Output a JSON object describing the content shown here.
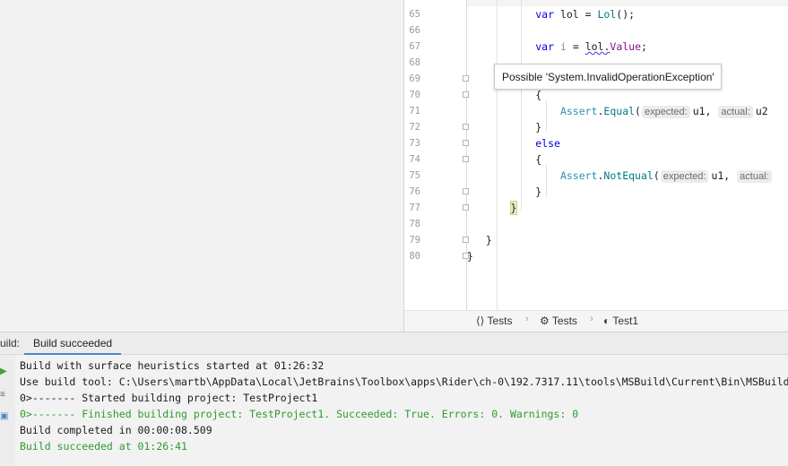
{
  "editor": {
    "lines": [
      {
        "num": "65",
        "code": [
          {
            "t": "var",
            "c": "kw"
          },
          {
            "t": " lol = ",
            "c": ""
          },
          {
            "t": "Lol",
            "c": "mc"
          },
          {
            "t": "();",
            "c": ""
          }
        ]
      },
      {
        "num": "66",
        "code": []
      },
      {
        "num": "67",
        "code": [
          {
            "t": "var",
            "c": "kw"
          },
          {
            "t": " ",
            "c": ""
          },
          {
            "t": "i",
            "c": "unused"
          },
          {
            "t": " = ",
            "c": ""
          },
          {
            "t": "lol",
            "c": "squiggle"
          },
          {
            "t": ".",
            "c": "squiggle"
          },
          {
            "t": "Value",
            "c": "prop"
          },
          {
            "t": ";",
            "c": ""
          }
        ]
      },
      {
        "num": "68",
        "code": []
      },
      {
        "num": "69",
        "code": []
      },
      {
        "num": "70",
        "code": [
          {
            "t": "{",
            "c": ""
          }
        ]
      },
      {
        "num": "71",
        "code": [
          {
            "t": "Assert",
            "c": "ty"
          },
          {
            "t": ".",
            "c": ""
          },
          {
            "t": "Equal",
            "c": "mc"
          },
          {
            "t": "(",
            "c": ""
          },
          {
            "hint": "expected:"
          },
          {
            "t": "u1, ",
            "c": ""
          },
          {
            "hint": "actual:"
          },
          {
            "t": "u2",
            "c": ""
          }
        ]
      },
      {
        "num": "72",
        "code": [
          {
            "t": "}",
            "c": ""
          }
        ]
      },
      {
        "num": "73",
        "code": [
          {
            "t": "else",
            "c": "kw"
          }
        ]
      },
      {
        "num": "74",
        "code": [
          {
            "t": "{",
            "c": ""
          }
        ]
      },
      {
        "num": "75",
        "code": [
          {
            "t": "Assert",
            "c": "ty"
          },
          {
            "t": ".",
            "c": ""
          },
          {
            "t": "NotEqual",
            "c": "mc"
          },
          {
            "t": "(",
            "c": ""
          },
          {
            "hint": "expected:"
          },
          {
            "t": "u1, ",
            "c": ""
          },
          {
            "hint": "actual:"
          }
        ]
      },
      {
        "num": "76",
        "code": [
          {
            "t": "}",
            "c": ""
          }
        ]
      },
      {
        "num": "77",
        "code": [
          {
            "t": "}",
            "c": "brace-hl"
          }
        ]
      },
      {
        "num": "78",
        "code": []
      },
      {
        "num": "79",
        "code": [
          {
            "t": "}",
            "c": ""
          }
        ]
      },
      {
        "num": "80",
        "code": [
          {
            "t": "}",
            "c": ""
          }
        ]
      }
    ],
    "tooltip": "Possible 'System.InvalidOperationException'"
  },
  "breadcrumb": [
    {
      "icon": "⟨⟩",
      "label": "Tests"
    },
    {
      "icon": "⚙",
      "label": "Tests"
    },
    {
      "icon": "◐",
      "label": "Test1"
    }
  ],
  "build": {
    "header_label": "uild:",
    "tab_label": "Build succeeded",
    "output": [
      {
        "text": "Build with surface heuristics started at 01:26:32",
        "green": false
      },
      {
        "text": "Use build tool: C:\\Users\\martb\\AppData\\Local\\JetBrains\\Toolbox\\apps\\Rider\\ch-0\\192.7317.11\\tools\\MSBuild\\Current\\Bin\\MSBuild.exe",
        "green": false
      },
      {
        "text": "0>------- Started building project: TestProject1",
        "green": false
      },
      {
        "text": "0>------- Finished building project: TestProject1. Succeeded: True. Errors: 0. Warnings: 0",
        "green": true
      },
      {
        "text": "Build completed in 00:00:08.509",
        "green": false
      },
      {
        "text": "Build succeeded at 01:26:41",
        "green": true
      }
    ]
  },
  "colors": {
    "accent": "#4a88c7",
    "success": "#2f9a2f",
    "keyword": "#0000e6"
  }
}
